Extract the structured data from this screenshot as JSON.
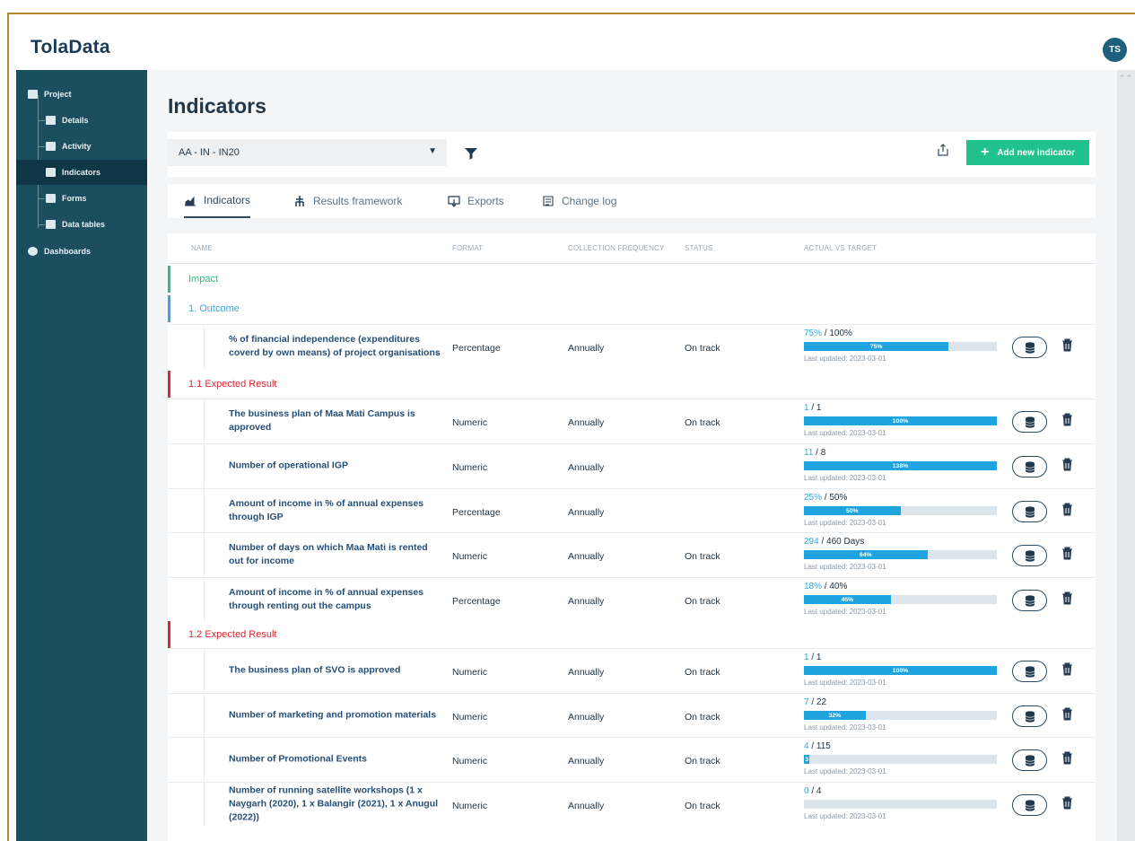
{
  "app": {
    "logo_text": "TolaData",
    "user_initials": "TS"
  },
  "sidebar": {
    "items": [
      {
        "label": "Project",
        "icon": "project-icon",
        "active": false
      },
      {
        "label": "Details",
        "icon": "clipboard-icon",
        "active": false
      },
      {
        "label": "Activity",
        "icon": "activity-icon",
        "active": false
      },
      {
        "label": "Indicators",
        "icon": "bar-chart-icon",
        "active": true
      },
      {
        "label": "Forms",
        "icon": "form-icon",
        "active": false
      },
      {
        "label": "Data tables",
        "icon": "table-icon",
        "active": false
      },
      {
        "label": "Dashboards",
        "icon": "dashboard-icon",
        "active": false
      }
    ]
  },
  "page": {
    "title": "Indicators",
    "program_select": "AA - IN - IN20",
    "add_button": "Add new indicator"
  },
  "tabs": [
    {
      "label": "Indicators",
      "icon": "indicators-icon",
      "active": true
    },
    {
      "label": "Results framework",
      "icon": "hierarchy-icon",
      "active": false
    },
    {
      "label": "Exports",
      "icon": "export-icon",
      "active": false
    },
    {
      "label": "Change log",
      "icon": "log-icon",
      "active": false
    }
  ],
  "table": {
    "headers": {
      "name": "NAME",
      "format": "FORMAT",
      "frequency": "COLLECTION FREQUENCY",
      "status": "STATUS",
      "actual_vs_target": "ACTUAL VS TARGET"
    },
    "groups": [
      {
        "label": "Impact",
        "kind": "impact"
      },
      {
        "label": "1. Outcome",
        "kind": "outcome"
      },
      {
        "label": "1.1 Expected Result",
        "kind": "result"
      },
      {
        "label": "1.2 Expected Result",
        "kind": "result"
      }
    ],
    "rows": [
      {
        "name": "% of financial independence (expenditures coverd by own means) of project organisations",
        "format": "Percentage",
        "frequency": "Annually",
        "status": "On track",
        "actual": "75%",
        "target": "100%",
        "percent": 75,
        "percent_label": "75%",
        "updated": "Last updated: 2023-03-01"
      },
      {
        "name": "The business plan of Maa Mati Campus is approved",
        "format": "Numeric",
        "frequency": "Annually",
        "status": "On track",
        "actual": "1",
        "target": "1",
        "percent": 100,
        "percent_label": "100%",
        "updated": "Last updated: 2023-03-01"
      },
      {
        "name": "Number of operational IGP",
        "format": "Numeric",
        "frequency": "Annually",
        "status": "",
        "actual": "11",
        "target": "8",
        "percent": 138,
        "percent_label": "138%",
        "updated": "Last updated: 2023-03-01"
      },
      {
        "name": "Amount of income in % of annual expenses through IGP",
        "format": "Percentage",
        "frequency": "Annually",
        "status": "",
        "actual": "25%",
        "target": "50%",
        "percent": 50,
        "percent_label": "50%",
        "updated": "Last updated: 2023-03-01"
      },
      {
        "name": "Number of days on which Maa Mati is rented out for income",
        "format": "Numeric",
        "frequency": "Annually",
        "status": "On track",
        "actual": "294",
        "target": "460 Days",
        "percent": 64,
        "percent_label": "64%",
        "updated": "Last updated: 2023-03-01"
      },
      {
        "name": "Amount of income in % of annual expenses through renting out the campus",
        "format": "Percentage",
        "frequency": "Annually",
        "status": "On track",
        "actual": "18%",
        "target": "40%",
        "percent": 45,
        "percent_label": "45%",
        "updated": "Last updated: 2023-03-01"
      },
      {
        "name": "The business plan of SVO is approved",
        "format": "Numeric",
        "frequency": "Annually",
        "status": "On track",
        "actual": "1",
        "target": "1",
        "percent": 100,
        "percent_label": "100%",
        "updated": "Last updated: 2023-03-01"
      },
      {
        "name": "Number of marketing and promotion materials",
        "format": "Numeric",
        "frequency": "Annually",
        "status": "On track",
        "actual": "7",
        "target": "22",
        "percent": 32,
        "percent_label": "32%",
        "updated": "Last updated: 2023-03-01"
      },
      {
        "name": "Number of Promotional Events",
        "format": "Numeric",
        "frequency": "Annually",
        "status": "On track",
        "actual": "4",
        "target": "115",
        "percent": 3,
        "percent_label": "3",
        "updated": "Last updated: 2023-03-01"
      },
      {
        "name": "Number of running satellite workshops (1 x Naygarh (2020), 1 x Balangir (2021), 1 x Anugul (2022))",
        "format": "Numeric",
        "frequency": "Annually",
        "status": "On track",
        "actual": "0",
        "target": "4",
        "percent": 0,
        "percent_label": "",
        "updated": "Last updated: 2023-03-01"
      }
    ]
  },
  "colors": {
    "sidebar": "#1b4e5f",
    "accent_green": "#21c18d",
    "progress_blue": "#20a4df",
    "expected_red": "#e1272f"
  }
}
